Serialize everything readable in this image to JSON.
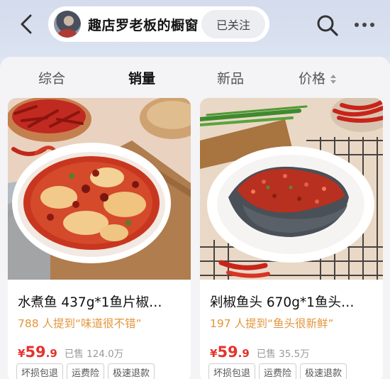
{
  "header": {
    "back_icon": "chevron-left-icon",
    "shop_name": "趣店罗老板的橱窗",
    "follow_label": "已关注",
    "search_icon": "search-icon",
    "more_icon": "more-dots-icon"
  },
  "tabs": [
    {
      "label": "综合",
      "active": false
    },
    {
      "label": "销量",
      "active": true
    },
    {
      "label": "新品",
      "active": false
    },
    {
      "label": "价格",
      "active": false
    }
  ],
  "products": [
    {
      "title": "水煮鱼 437g*1鱼片椒…",
      "mention": "788 人提到“味道很不错”",
      "price_symbol": "¥",
      "price_int": "59",
      "price_dec": ".9",
      "sold": "已售 124.0万",
      "tags": [
        "坏损包退",
        "运费险",
        "极速退款"
      ]
    },
    {
      "title": "剁椒鱼头 670g*1鱼头…",
      "mention": "197 人提到“鱼头很新鲜”",
      "price_symbol": "¥",
      "price_int": "59",
      "price_dec": ".9",
      "sold": "已售 35.5万",
      "tags": [
        "坏损包退",
        "运费险",
        "极速退款"
      ]
    }
  ],
  "colors": {
    "price": "#e5322d",
    "mention": "#e3953a",
    "header_bg": "#d4dced",
    "panel_bg": "#f4f4f6"
  }
}
